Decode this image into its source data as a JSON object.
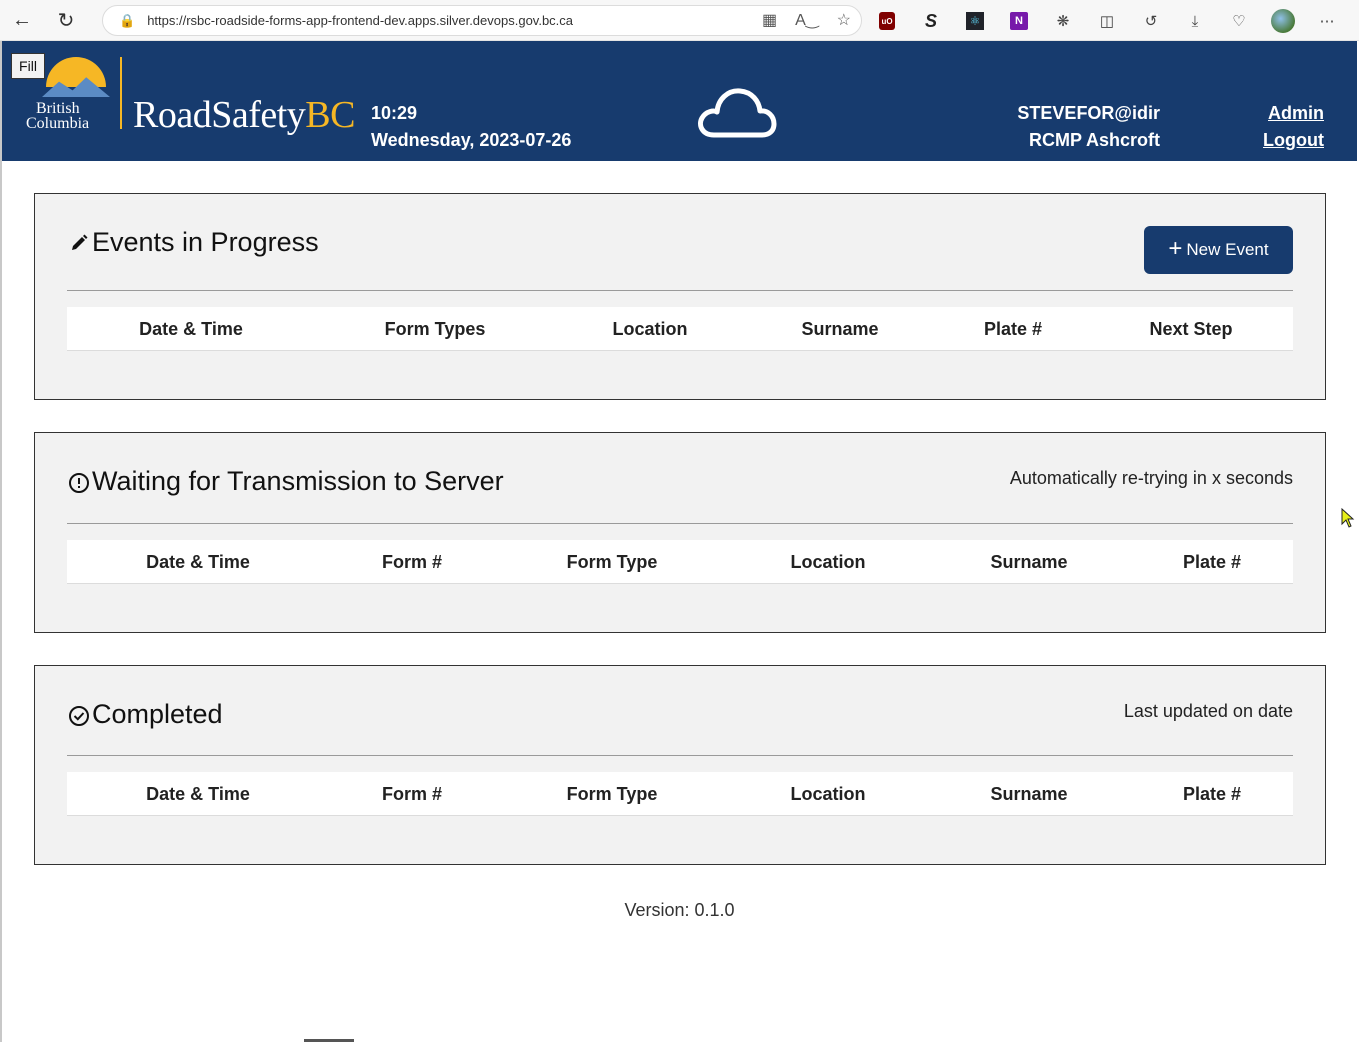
{
  "browser": {
    "url": "https://rsbc-roadside-forms-app-frontend-dev.apps.silver.devops.gov.bc.ca",
    "extensions": [
      "ublock-icon",
      "s-icon",
      "react-devtools-icon",
      "onenote-icon",
      "extensions-icon",
      "split-screen-icon",
      "history-icon",
      "downloads-icon",
      "browser-essentials-icon",
      "profile-avatar",
      "more-icon"
    ]
  },
  "header": {
    "fill_label": "Fill",
    "logo_line1": "British",
    "logo_line2": "Columbia",
    "brand_main": "RoadSafety",
    "brand_accent": "BC",
    "time": "10:29",
    "date": "Wednesday, 2023-07-26",
    "status_icon": "cloud-icon",
    "user": "STEVEFOR@idir",
    "org": "RCMP Ashcroft",
    "admin_link": "Admin",
    "logout_link": "Logout"
  },
  "panels": {
    "in_progress": {
      "title": "Events in Progress",
      "icon": "pencil-icon",
      "button": "New Event",
      "columns": [
        "Date & Time",
        "Form Types",
        "Location",
        "Surname",
        "Plate #",
        "Next Step"
      ]
    },
    "waiting": {
      "title": "Waiting for Transmission to Server",
      "icon": "alert-circle-icon",
      "note": "Automatically re-trying in x seconds",
      "columns": [
        "Date & Time",
        "Form #",
        "Form Type",
        "Location",
        "Surname",
        "Plate #"
      ]
    },
    "completed": {
      "title": "Completed",
      "icon": "check-circle-icon",
      "note": "Last updated on date",
      "columns": [
        "Date & Time",
        "Form #",
        "Form Type",
        "Location",
        "Surname",
        "Plate #"
      ]
    }
  },
  "footer": {
    "version": "Version: 0.1.0"
  }
}
